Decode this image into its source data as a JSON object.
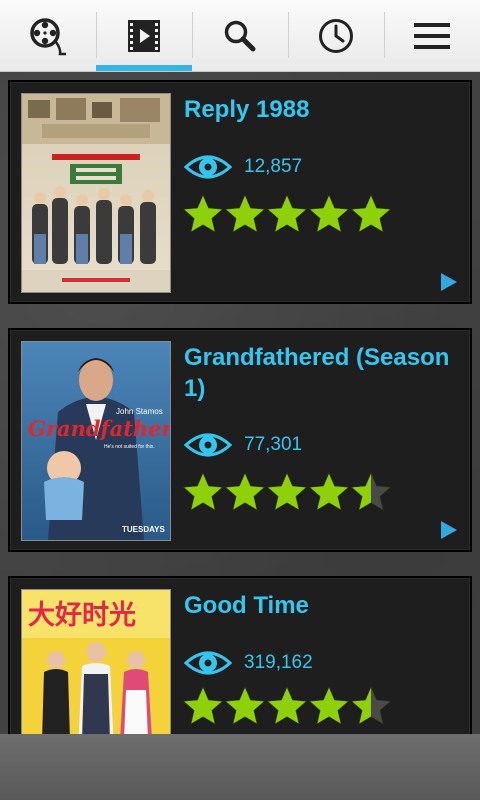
{
  "tabs": [
    {
      "icon": "film-reel-icon",
      "active": false
    },
    {
      "icon": "film-strip-icon",
      "active": true
    },
    {
      "icon": "search-icon",
      "active": false
    },
    {
      "icon": "clock-icon",
      "active": false
    },
    {
      "icon": "menu-icon",
      "active": false
    }
  ],
  "colors": {
    "accent": "#33b5e5",
    "title": "#33c6ef",
    "star_fill": "#8ed10a",
    "star_empty": "#4a4a4a",
    "card_bg": "#1e1e1e"
  },
  "shows": [
    {
      "title": "Reply 1988",
      "views": "12,857",
      "rating": 5,
      "rating_max": 5,
      "poster_icon": "poster-reply-1988-image"
    },
    {
      "title": "Grandfathered (Season 1)",
      "views": "77,301",
      "rating": 4.5,
      "rating_max": 5,
      "poster_icon": "poster-grandfathered-image",
      "poster_text": {
        "title": "Grandfathered",
        "actor": "John Stamos",
        "tagline": "He's not suited for this.",
        "day": "TUESDAYS"
      }
    },
    {
      "title": "Good Time",
      "views": "319,162",
      "rating": 4.5,
      "rating_max": 5,
      "poster_icon": "poster-good-time-image",
      "poster_text": {
        "title": "大好时光"
      }
    }
  ]
}
